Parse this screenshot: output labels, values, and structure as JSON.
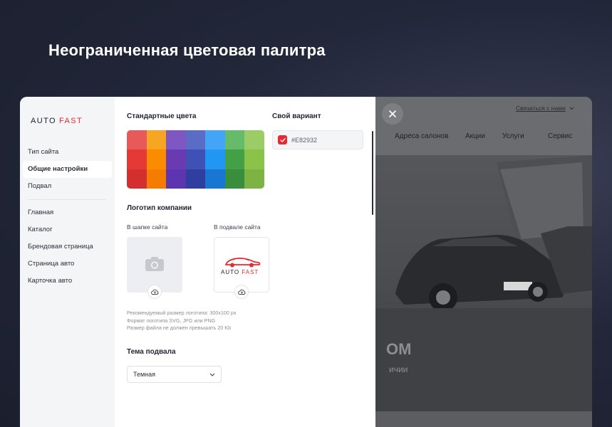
{
  "headline": "Неограниченная цветовая палитра",
  "sidebar": {
    "logo_auto": "AUTO",
    "logo_fast": "FAST",
    "items": [
      {
        "label": "Тип сайта"
      },
      {
        "label": "Общие настройки"
      },
      {
        "label": "Подвал"
      },
      {
        "label": "Главная"
      },
      {
        "label": "Каталог"
      },
      {
        "label": "Брендовая страница"
      },
      {
        "label": "Страница авто"
      },
      {
        "label": "Карточка авто"
      }
    ],
    "active_item": "Общие настройки"
  },
  "colors": {
    "standard_title": "Стандартные цвета",
    "palette": [
      [
        "#e85a5a",
        "#f6a623",
        "#7e57c2",
        "#5b6cc7",
        "#42a5f5",
        "#66bb6a",
        "#9ccc65"
      ],
      [
        "#e53935",
        "#fb8c00",
        "#6a3ab2",
        "#3f51b5",
        "#2196f3",
        "#43a047",
        "#8bc34a"
      ],
      [
        "#d32f2f",
        "#f57c00",
        "#5e35b1",
        "#303f9f",
        "#1976d2",
        "#388e3c",
        "#7cb342"
      ]
    ],
    "custom_title": "Свой вариант",
    "custom_hex": "#E82932",
    "custom_color": "#e82932"
  },
  "logos": {
    "title": "Логотип компании",
    "header_label": "В шапке сайта",
    "footer_label": "В подвале сайта",
    "footer_logo_auto": "AUTO",
    "footer_logo_fast": "FAST",
    "hints": [
      "Рекомендуемый размер логотипа: 300х100 px",
      "Формат логотипа SVG, JPG или PNG",
      "Размер файла не должен превышать 20 Kb"
    ]
  },
  "footer_theme": {
    "title": "Тема подвала",
    "value": "Темная"
  },
  "preview": {
    "contact": "Связаться с нами",
    "menu": [
      "Адреса салонов",
      "Акции",
      "Услуги",
      "Сервис"
    ],
    "hero_big": "ОМ",
    "hero_small": "ичии"
  }
}
